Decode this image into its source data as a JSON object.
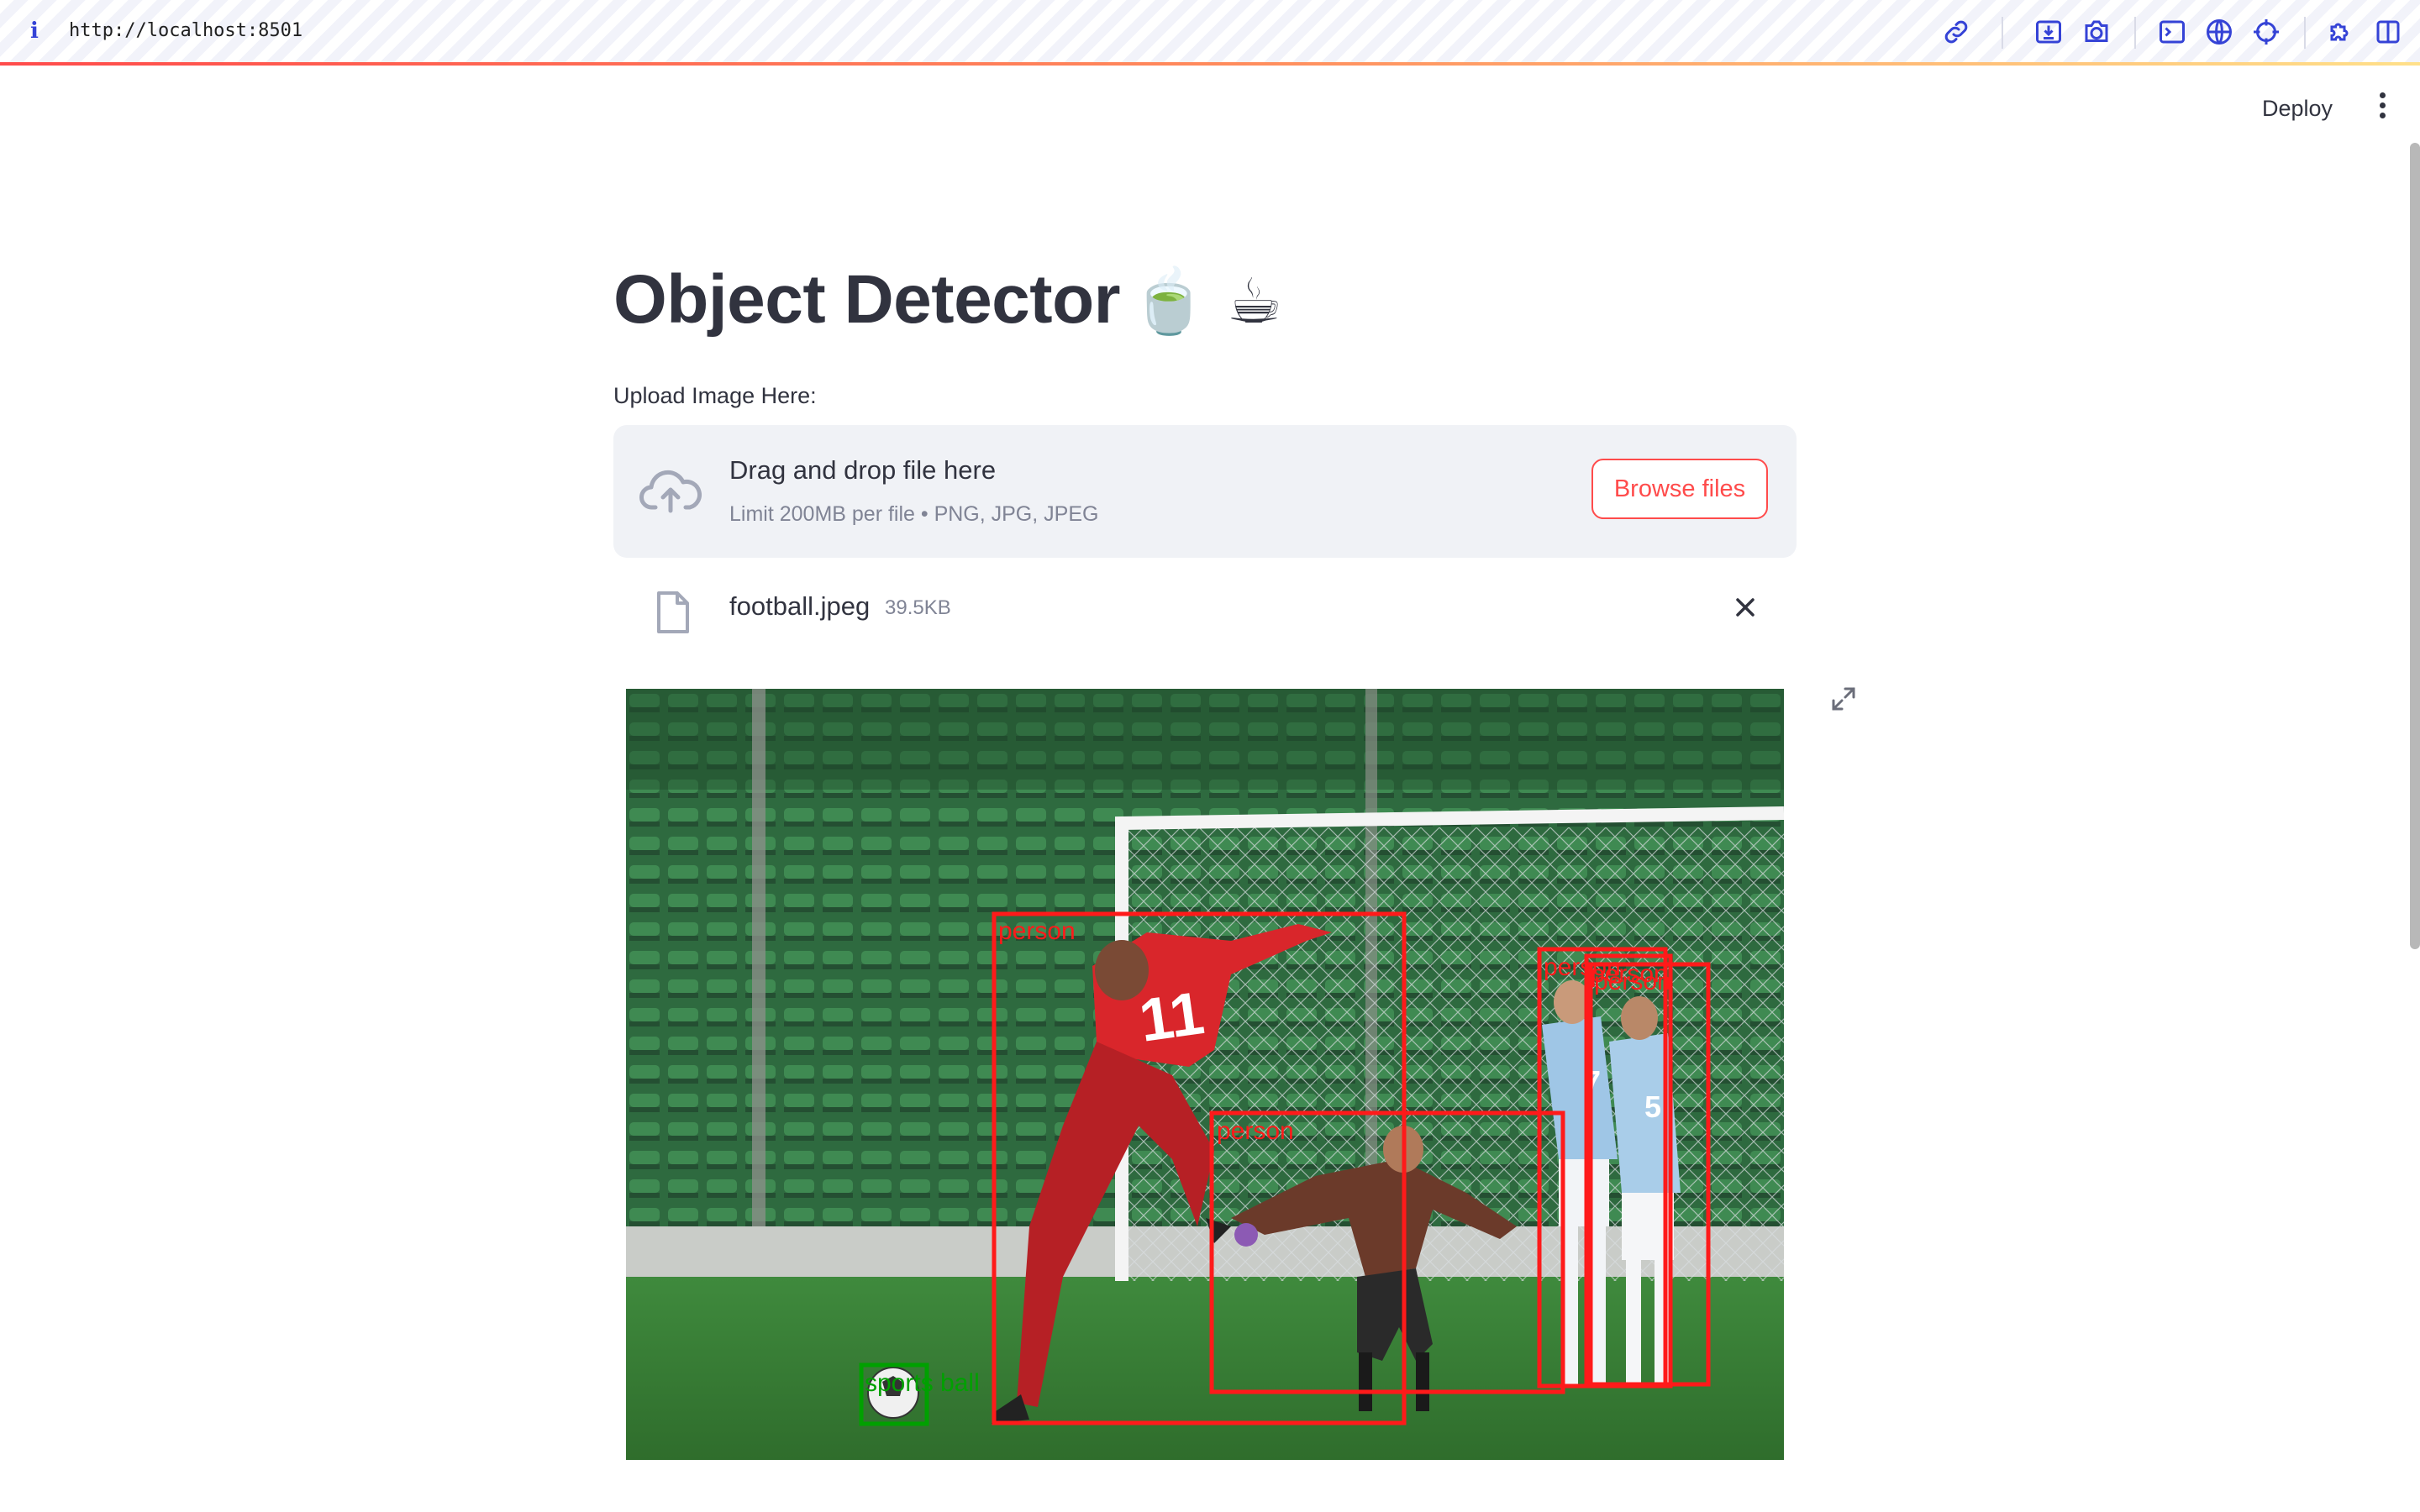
{
  "browser": {
    "info_icon": "i",
    "url": "http://localhost:8501",
    "toolbar_icons": [
      "link-icon",
      "download-icon",
      "camera-icon",
      "terminal-icon",
      "globe-icon",
      "crosshair-icon",
      "extension-icon",
      "sidebar-icon"
    ]
  },
  "header": {
    "deploy_label": "Deploy",
    "menu_icon": "kebab-menu-icon"
  },
  "main": {
    "title": "Object Detector",
    "title_emoji": "🍵 ☕",
    "uploader": {
      "label": "Upload Image Here:",
      "drag_text": "Drag and drop file here",
      "limit_text": "Limit 200MB per file • PNG, JPG, JPEG",
      "browse_label": "Browse files",
      "icon": "cloud-upload-icon"
    },
    "uploaded_file": {
      "name": "football.jpeg",
      "size": "39.5KB",
      "icon": "file-icon",
      "remove_icon": "close-icon"
    },
    "image": {
      "description_icon": "fullscreen-icon",
      "detections": [
        {
          "label": "person",
          "color": "#ff1a1a"
        },
        {
          "label": "person",
          "color": "#ff1a1a"
        },
        {
          "label": "person",
          "color": "#ff1a1a"
        },
        {
          "label": "person",
          "color": "#ff1a1a"
        },
        {
          "label": "person",
          "color": "#ff1a1a"
        },
        {
          "label": "sports ball",
          "color": "#00a000"
        }
      ]
    }
  },
  "colors": {
    "accent": "#ff4b4b",
    "text": "#31333f",
    "muted": "#808495",
    "toolbar_icon": "#3543d6",
    "dropzone_bg": "#f0f2f6"
  }
}
